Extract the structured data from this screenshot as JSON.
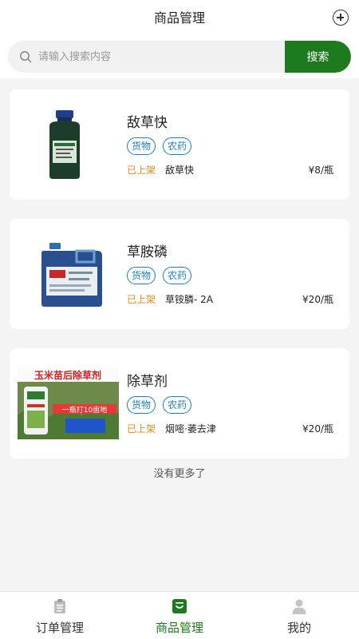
{
  "header": {
    "title": "商品管理",
    "add_icon": "plus-circle-icon"
  },
  "search": {
    "placeholder": "请输入搜索内容",
    "value": "",
    "button_label": "搜索",
    "icon": "search-icon"
  },
  "products": [
    {
      "name": "敌草快",
      "tags": [
        "货物",
        "农药"
      ],
      "status": "已上架",
      "spec": "敌草快",
      "price": "¥8/瓶",
      "image": "herbicide-bottle"
    },
    {
      "name": "草胺磷",
      "tags": [
        "货物",
        "农药"
      ],
      "status": "已上架",
      "spec": "草铵膦- 2A",
      "price": "¥20/瓶",
      "image": "blue-jerrycan"
    },
    {
      "name": "除草剂",
      "tags": [
        "货物",
        "农药"
      ],
      "status": "已上架",
      "spec": "烟嘧·萎去津",
      "price": "¥20/瓶",
      "image": "corn-herbicide-ad",
      "image_text": {
        "headline": "玉米苗后除草剂",
        "banner": "一瓶打10亩地"
      }
    }
  ],
  "list_end_text": "没有更多了",
  "tabbar": [
    {
      "label": "订单管理",
      "icon": "clipboard-icon",
      "active": false
    },
    {
      "label": "商品管理",
      "icon": "product-box-icon",
      "active": true
    },
    {
      "label": "我的",
      "icon": "user-icon",
      "active": false
    }
  ],
  "colors": {
    "primary": "#1e7a1e",
    "tag": "#1a7fc9",
    "status": "#e8891c",
    "background": "#f4f4f4"
  }
}
